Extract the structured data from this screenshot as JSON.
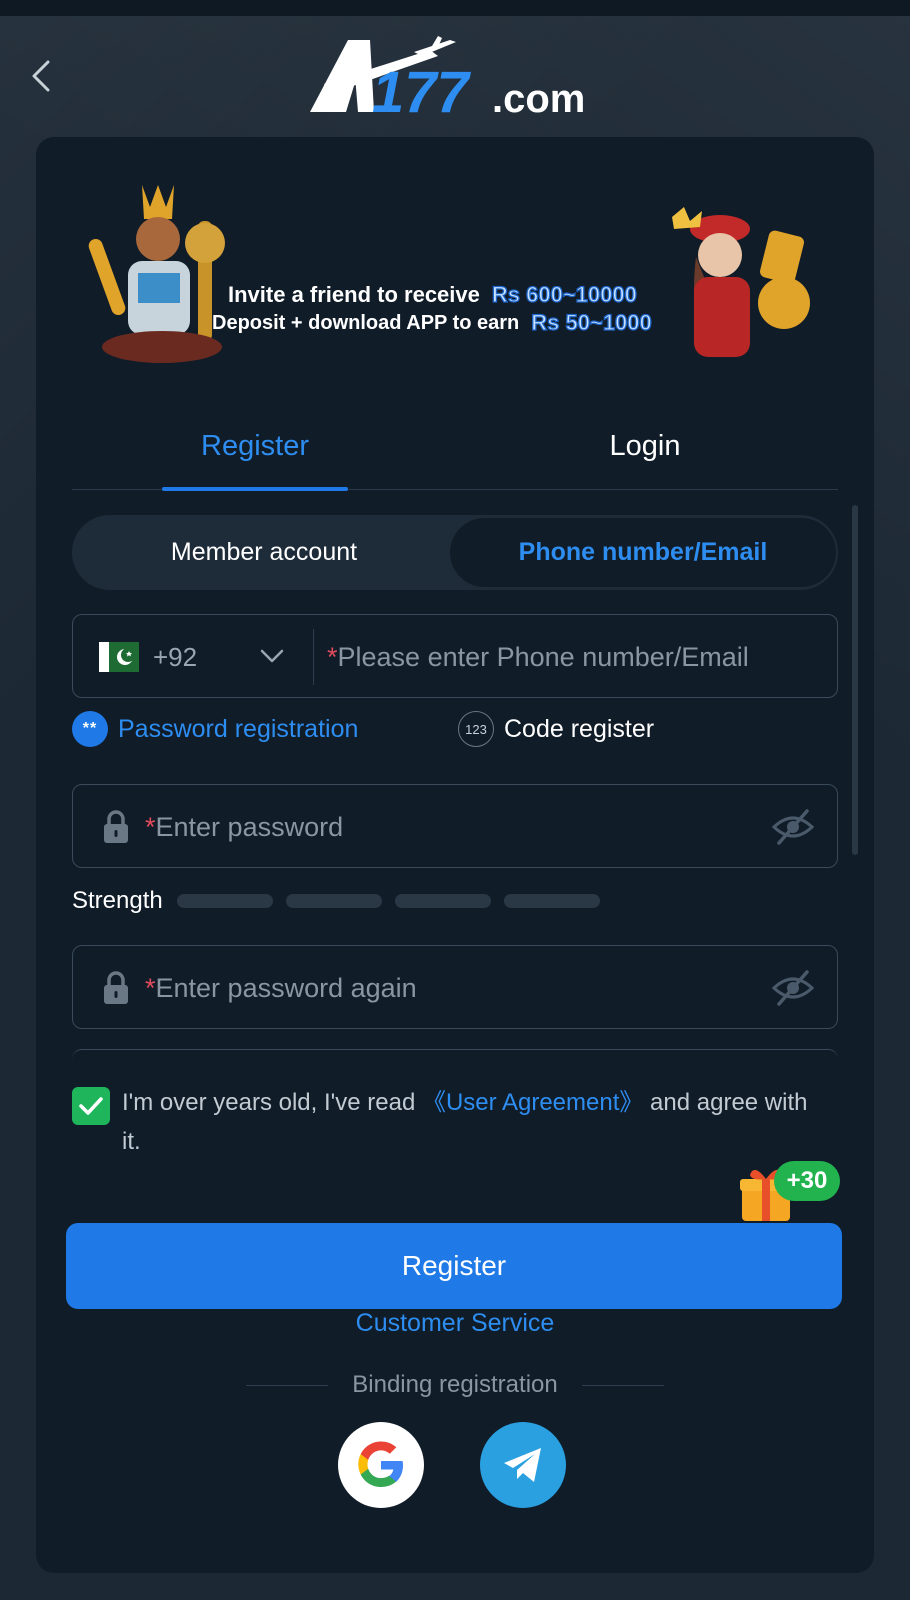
{
  "header": {
    "logo_text_main": "A177",
    "logo_text_suffix": ".com"
  },
  "banner": {
    "line1_text": "Invite a friend to receive",
    "line1_amount": "Rs 600~10000",
    "line2_text": "Deposit + download APP to earn",
    "line2_amount": "Rs 50~1000"
  },
  "tabs": [
    {
      "label": "Register",
      "active": true
    },
    {
      "label": "Login",
      "active": false
    }
  ],
  "account_type": {
    "options": [
      "Member account",
      "Phone number/Email"
    ],
    "selected": "Phone number/Email"
  },
  "phone": {
    "country_code": "+92",
    "required_mark": "*",
    "placeholder": "Please enter Phone number/Email"
  },
  "register_modes": {
    "password_icon": "**",
    "password_label": "Password registration",
    "code_icon": "123",
    "code_label": "Code register",
    "selected": "Password registration"
  },
  "password": {
    "required_mark": "*",
    "placeholder": "Enter password"
  },
  "strength": {
    "label": "Strength",
    "segments": 4,
    "filled": 0
  },
  "password_confirm": {
    "required_mark": "*",
    "placeholder": "Enter password again"
  },
  "agreement": {
    "checked": true,
    "text_before": "I'm over years old, I've read ",
    "link": "《User Agreement》",
    "text_after": " and agree with it."
  },
  "bonus": {
    "badge": "+30"
  },
  "actions": {
    "register_label": "Register",
    "customer_service_label": "Customer Service",
    "binding_label": "Binding registration"
  },
  "social": [
    {
      "name": "google-icon"
    },
    {
      "name": "telegram-icon"
    }
  ],
  "colors": {
    "accent": "#1f7ae8",
    "link": "#2e8df0",
    "success": "#1fb55a",
    "required": "#e24b5c",
    "card_bg": "#101c28",
    "page_bg": "#1c2834"
  }
}
